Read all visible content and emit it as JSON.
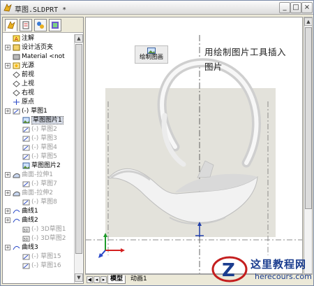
{
  "window": {
    "title": "草图.SLDPRT *"
  },
  "title_buttons": {
    "minimize": "_",
    "maximize": "□",
    "close": "×"
  },
  "panel_tabs": [
    "feature-manager",
    "property-manager",
    "configuration-manager",
    "display-manager"
  ],
  "tree": [
    {
      "label": "注解",
      "icon": "annotation-icon",
      "state": "normal",
      "expandable": false
    },
    {
      "label": "设计活页夹",
      "icon": "design-binder-icon",
      "state": "normal",
      "expandable": true
    },
    {
      "label": "Material <not",
      "icon": "material-icon",
      "state": "normal",
      "expandable": false
    },
    {
      "label": "光源",
      "icon": "lights-icon",
      "state": "normal",
      "expandable": true
    },
    {
      "label": "前视",
      "icon": "plane-icon",
      "state": "normal",
      "expandable": false
    },
    {
      "label": "上视",
      "icon": "plane-icon",
      "state": "normal",
      "expandable": false
    },
    {
      "label": "右视",
      "icon": "plane-icon",
      "state": "normal",
      "expandable": false
    },
    {
      "label": "原点",
      "icon": "origin-icon",
      "state": "normal",
      "expandable": false
    },
    {
      "label": "(-) 草图1",
      "icon": "sketch-icon",
      "state": "normal",
      "expandable": true
    },
    {
      "label": "草图图片1",
      "icon": "sketch-picture-icon",
      "state": "selected",
      "expandable": false
    },
    {
      "label": "(-) 草图2",
      "icon": "sketch-icon",
      "state": "dim",
      "expandable": false
    },
    {
      "label": "(-) 草图3",
      "icon": "sketch-icon",
      "state": "dim",
      "expandable": false
    },
    {
      "label": "(-) 草图4",
      "icon": "sketch-icon",
      "state": "dim",
      "expandable": false
    },
    {
      "label": "(-) 草图5",
      "icon": "sketch-icon",
      "state": "dim",
      "expandable": false
    },
    {
      "label": "草图图片2",
      "icon": "sketch-picture-icon",
      "state": "normal",
      "expandable": false
    },
    {
      "label": "曲面-拉伸1",
      "icon": "surface-icon",
      "state": "dim",
      "expandable": true
    },
    {
      "label": "(-) 草图7",
      "icon": "sketch-icon",
      "state": "dim",
      "expandable": false
    },
    {
      "label": "曲面-拉伸2",
      "icon": "surface-icon",
      "state": "dim",
      "expandable": true
    },
    {
      "label": "(-) 草图8",
      "icon": "sketch-icon",
      "state": "dim",
      "expandable": false
    },
    {
      "label": "曲线1",
      "icon": "curve-icon",
      "state": "normal",
      "expandable": true
    },
    {
      "label": "曲线2",
      "icon": "curve-icon",
      "state": "normal",
      "expandable": true
    },
    {
      "label": "(-) 3D草图1",
      "icon": "sketch3d-icon",
      "state": "dim",
      "expandable": false
    },
    {
      "label": "(-) 3D草图2",
      "icon": "sketch3d-icon",
      "state": "dim",
      "expandable": false
    },
    {
      "label": "曲线3",
      "icon": "curve-icon",
      "state": "normal",
      "expandable": true
    },
    {
      "label": "(-) 草图15",
      "icon": "sketch-icon",
      "state": "dim",
      "expandable": false
    },
    {
      "label": "(-) 草图16",
      "icon": "sketch-icon",
      "state": "dim",
      "expandable": false
    }
  ],
  "toolbar": {
    "sketch_picture_label": "绘制图画"
  },
  "caption": "用绘制图片工具插入图片",
  "bottom_tabs": {
    "model": "模型",
    "animation": "动画1"
  },
  "watermark": {
    "name": "这里教程网",
    "url": "herecours.com"
  },
  "colors": {
    "title_gradient_top": "#fbfbfb",
    "selection": "#d6dbe6",
    "dim_text": "#9b9b9b",
    "triad_x": "#d42020",
    "triad_y": "#1e9b2a",
    "triad_z": "#2a49c8"
  }
}
